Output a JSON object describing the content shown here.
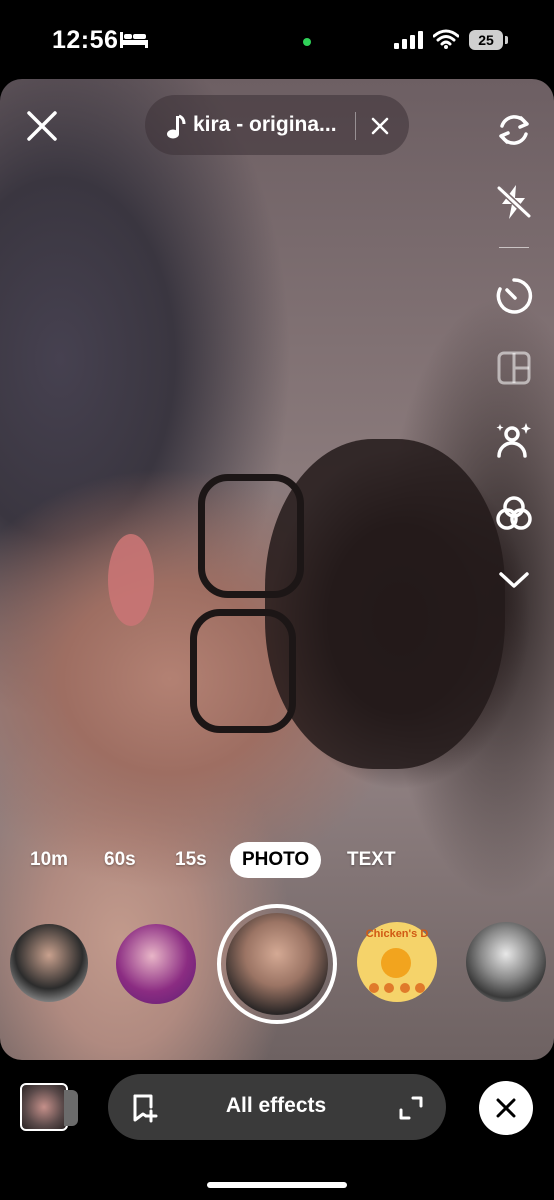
{
  "status_bar": {
    "time": "12:56",
    "battery": "25",
    "icons": [
      "bed-icon",
      "camera-in-use-dot",
      "cellular-signal-icon",
      "wifi-icon",
      "battery-icon"
    ]
  },
  "camera": {
    "sound": {
      "title": "kira - origina..."
    },
    "side_tools": [
      "flip-camera-icon",
      "flash-off-icon",
      "timer-icon",
      "layout-icon",
      "retouch-icon",
      "filters-icon",
      "chevron-down-icon"
    ]
  },
  "modes": [
    {
      "label": "10m",
      "active": false
    },
    {
      "label": "60s",
      "active": false
    },
    {
      "label": "15s",
      "active": false
    },
    {
      "label": "PHOTO",
      "active": true
    },
    {
      "label": "TEXT",
      "active": false
    }
  ],
  "effects": {
    "items": [
      {
        "name": "effect-portrait-man"
      },
      {
        "name": "effect-portrait-purple"
      },
      {
        "name": "effect-portrait-selected",
        "selected": true
      },
      {
        "name": "effect-chickens",
        "label": "Chicken's D"
      },
      {
        "name": "effect-portrait-vintage"
      }
    ]
  },
  "bottom_bar": {
    "all_effects_label": "All effects"
  },
  "colors": {
    "background": "#000000",
    "pill": "#3a3a3a",
    "active_mode_bg": "#ffffff",
    "camera_dot": "#2fd158"
  }
}
